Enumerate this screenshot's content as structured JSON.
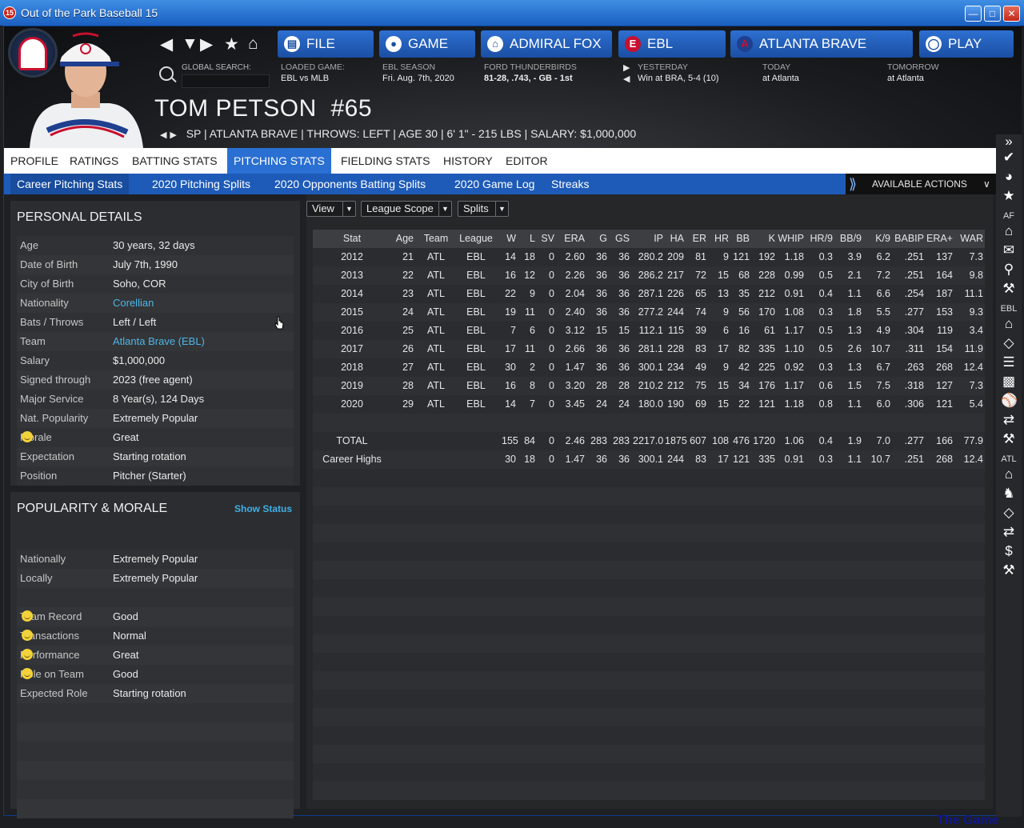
{
  "window": {
    "title": "Out of the Park Baseball 15",
    "icon_text": "15"
  },
  "nav": {
    "buttons": [
      {
        "label": "FILE",
        "icon": "file-icon"
      },
      {
        "label": "GAME",
        "icon": "globe-icon"
      },
      {
        "label": "ADMIRAL FOX",
        "icon": "home-icon"
      },
      {
        "label": "EBL",
        "icon": "league-logo-icon"
      },
      {
        "label": "ATLANTA BRAVE",
        "icon": "team-logo-icon"
      },
      {
        "label": "PLAY",
        "icon": "baseball-icon"
      }
    ],
    "search_label": "GLOBAL SEARCH:",
    "info": [
      {
        "label": "LOADED GAME:",
        "value": "EBL vs MLB"
      },
      {
        "label": "EBL SEASON",
        "value": "Fri. Aug. 7th, 2020"
      },
      {
        "label": "FORD THUNDERBIRDS",
        "value": "81-28, .743, - GB - 1st"
      },
      {
        "label": "YESTERDAY",
        "value": "Win at BRA, 5-4 (10)"
      },
      {
        "label": "TODAY",
        "value": "at Atlanta"
      },
      {
        "label": "TOMORROW",
        "value": "at Atlanta"
      }
    ]
  },
  "player": {
    "name": "TOM PETSON",
    "number": "#65",
    "line": "SP | ATLANTA BRAVE | THROWS: LEFT | AGE 30 | 6' 1\" - 215 LBS | SALARY: $1,000,000"
  },
  "tabs": [
    "PROFILE",
    "RATINGS",
    "BATTING STATS",
    "PITCHING STATS",
    "FIELDING STATS",
    "HISTORY",
    "EDITOR"
  ],
  "active_tab": "PITCHING STATS",
  "subtabs": [
    "Career Pitching Stats",
    "2020 Pitching Splits",
    "2020 Opponents Batting Splits",
    "2020 Game Log",
    "Streaks"
  ],
  "available_actions": "AVAILABLE ACTIONS",
  "sidebar": {
    "sections": [
      "AF",
      "EBL",
      "ATL"
    ]
  },
  "personal": {
    "title": "PERSONAL DETAILS",
    "rows": [
      {
        "k": "Age",
        "v": "30 years, 32 days"
      },
      {
        "k": "Date of Birth",
        "v": "July 7th, 1990"
      },
      {
        "k": "City of Birth",
        "v": "Soho, COR"
      },
      {
        "k": "Nationality",
        "v": "Corellian"
      },
      {
        "k": "Bats / Throws",
        "v": "Left / Left"
      },
      {
        "k": "Team",
        "v": "Atlanta Brave (EBL)"
      },
      {
        "k": "Salary",
        "v": "$1,000,000"
      },
      {
        "k": "Signed through",
        "v": "2023 (free agent)"
      },
      {
        "k": "Major Service",
        "v": "8 Year(s), 124 Days"
      },
      {
        "k": "Nat. Popularity",
        "v": "Extremely Popular"
      },
      {
        "k": "Morale",
        "v": "Great"
      },
      {
        "k": "Expectation",
        "v": "Starting rotation"
      },
      {
        "k": "Position",
        "v": "Pitcher (Starter)"
      }
    ]
  },
  "popularity": {
    "title": "POPULARITY & MORALE",
    "show_status": "Show Status",
    "rows": [
      {
        "k": "Nationally",
        "v": "Extremely Popular"
      },
      {
        "k": "Locally",
        "v": "Extremely Popular"
      },
      {
        "k": "",
        "v": ""
      },
      {
        "k": "Team Record",
        "v": "Good"
      },
      {
        "k": "Transactions",
        "v": "Normal"
      },
      {
        "k": "Performance",
        "v": "Great"
      },
      {
        "k": "Role on Team",
        "v": "Good"
      },
      {
        "k": "Expected Role",
        "v": "Starting rotation"
      }
    ]
  },
  "dropdowns": [
    "View",
    "League Scope",
    "Splits"
  ],
  "stats": {
    "headers": [
      "Stat",
      "Age",
      "Team",
      "League",
      "W",
      "L",
      "SV",
      "ERA",
      "G",
      "GS",
      "IP",
      "HA",
      "ER",
      "HR",
      "BB",
      "K",
      "WHIP",
      "HR/9",
      "BB/9",
      "K/9",
      "BABIP",
      "ERA+",
      "WAR"
    ],
    "rows": [
      [
        "2012",
        "21",
        "ATL",
        "EBL",
        "14",
        "18",
        "0",
        "2.60",
        "36",
        "36",
        "280.2",
        "209",
        "81",
        "9",
        "121",
        "192",
        "1.18",
        "0.3",
        "3.9",
        "6.2",
        ".251",
        "137",
        "7.3"
      ],
      [
        "2013",
        "22",
        "ATL",
        "EBL",
        "16",
        "12",
        "0",
        "2.26",
        "36",
        "36",
        "286.2",
        "217",
        "72",
        "15",
        "68",
        "228",
        "0.99",
        "0.5",
        "2.1",
        "7.2",
        ".251",
        "164",
        "9.8"
      ],
      [
        "2014",
        "23",
        "ATL",
        "EBL",
        "22",
        "9",
        "0",
        "2.04",
        "36",
        "36",
        "287.1",
        "226",
        "65",
        "13",
        "35",
        "212",
        "0.91",
        "0.4",
        "1.1",
        "6.6",
        ".254",
        "187",
        "11.1"
      ],
      [
        "2015",
        "24",
        "ATL",
        "EBL",
        "19",
        "11",
        "0",
        "2.40",
        "36",
        "36",
        "277.2",
        "244",
        "74",
        "9",
        "56",
        "170",
        "1.08",
        "0.3",
        "1.8",
        "5.5",
        ".277",
        "153",
        "9.3"
      ],
      [
        "2016",
        "25",
        "ATL",
        "EBL",
        "7",
        "6",
        "0",
        "3.12",
        "15",
        "15",
        "112.1",
        "115",
        "39",
        "6",
        "16",
        "61",
        "1.17",
        "0.5",
        "1.3",
        "4.9",
        ".304",
        "119",
        "3.4"
      ],
      [
        "2017",
        "26",
        "ATL",
        "EBL",
        "17",
        "11",
        "0",
        "2.66",
        "36",
        "36",
        "281.1",
        "228",
        "83",
        "17",
        "82",
        "335",
        "1.10",
        "0.5",
        "2.6",
        "10.7",
        ".311",
        "154",
        "11.9"
      ],
      [
        "2018",
        "27",
        "ATL",
        "EBL",
        "30",
        "2",
        "0",
        "1.47",
        "36",
        "36",
        "300.1",
        "234",
        "49",
        "9",
        "42",
        "225",
        "0.92",
        "0.3",
        "1.3",
        "6.7",
        ".263",
        "268",
        "12.4"
      ],
      [
        "2019",
        "28",
        "ATL",
        "EBL",
        "16",
        "8",
        "0",
        "3.20",
        "28",
        "28",
        "210.2",
        "212",
        "75",
        "15",
        "34",
        "176",
        "1.17",
        "0.6",
        "1.5",
        "7.5",
        ".318",
        "127",
        "7.3"
      ],
      [
        "2020",
        "29",
        "ATL",
        "EBL",
        "14",
        "7",
        "0",
        "3.45",
        "24",
        "24",
        "180.0",
        "190",
        "69",
        "15",
        "22",
        "121",
        "1.18",
        "0.8",
        "1.1",
        "6.0",
        ".306",
        "121",
        "5.4"
      ]
    ],
    "total": [
      "TOTAL",
      "",
      "",
      "",
      "155",
      "84",
      "0",
      "2.46",
      "283",
      "283",
      "2217.0",
      "1875",
      "607",
      "108",
      "476",
      "1720",
      "1.06",
      "0.4",
      "1.9",
      "7.0",
      ".277",
      "166",
      "77.9"
    ],
    "career_highs": [
      "Career Highs",
      "",
      "",
      "",
      "30",
      "18",
      "0",
      "1.47",
      "36",
      "36",
      "300.1",
      "244",
      "83",
      "17",
      "121",
      "335",
      "0.91",
      "0.3",
      "1.1",
      "10.7",
      ".251",
      "268",
      "12.4"
    ]
  },
  "watermark": "The Game",
  "colors": {
    "accent": "#2a6fd2",
    "link": "#4fb6e8",
    "titlebar": "#2a76d8"
  }
}
